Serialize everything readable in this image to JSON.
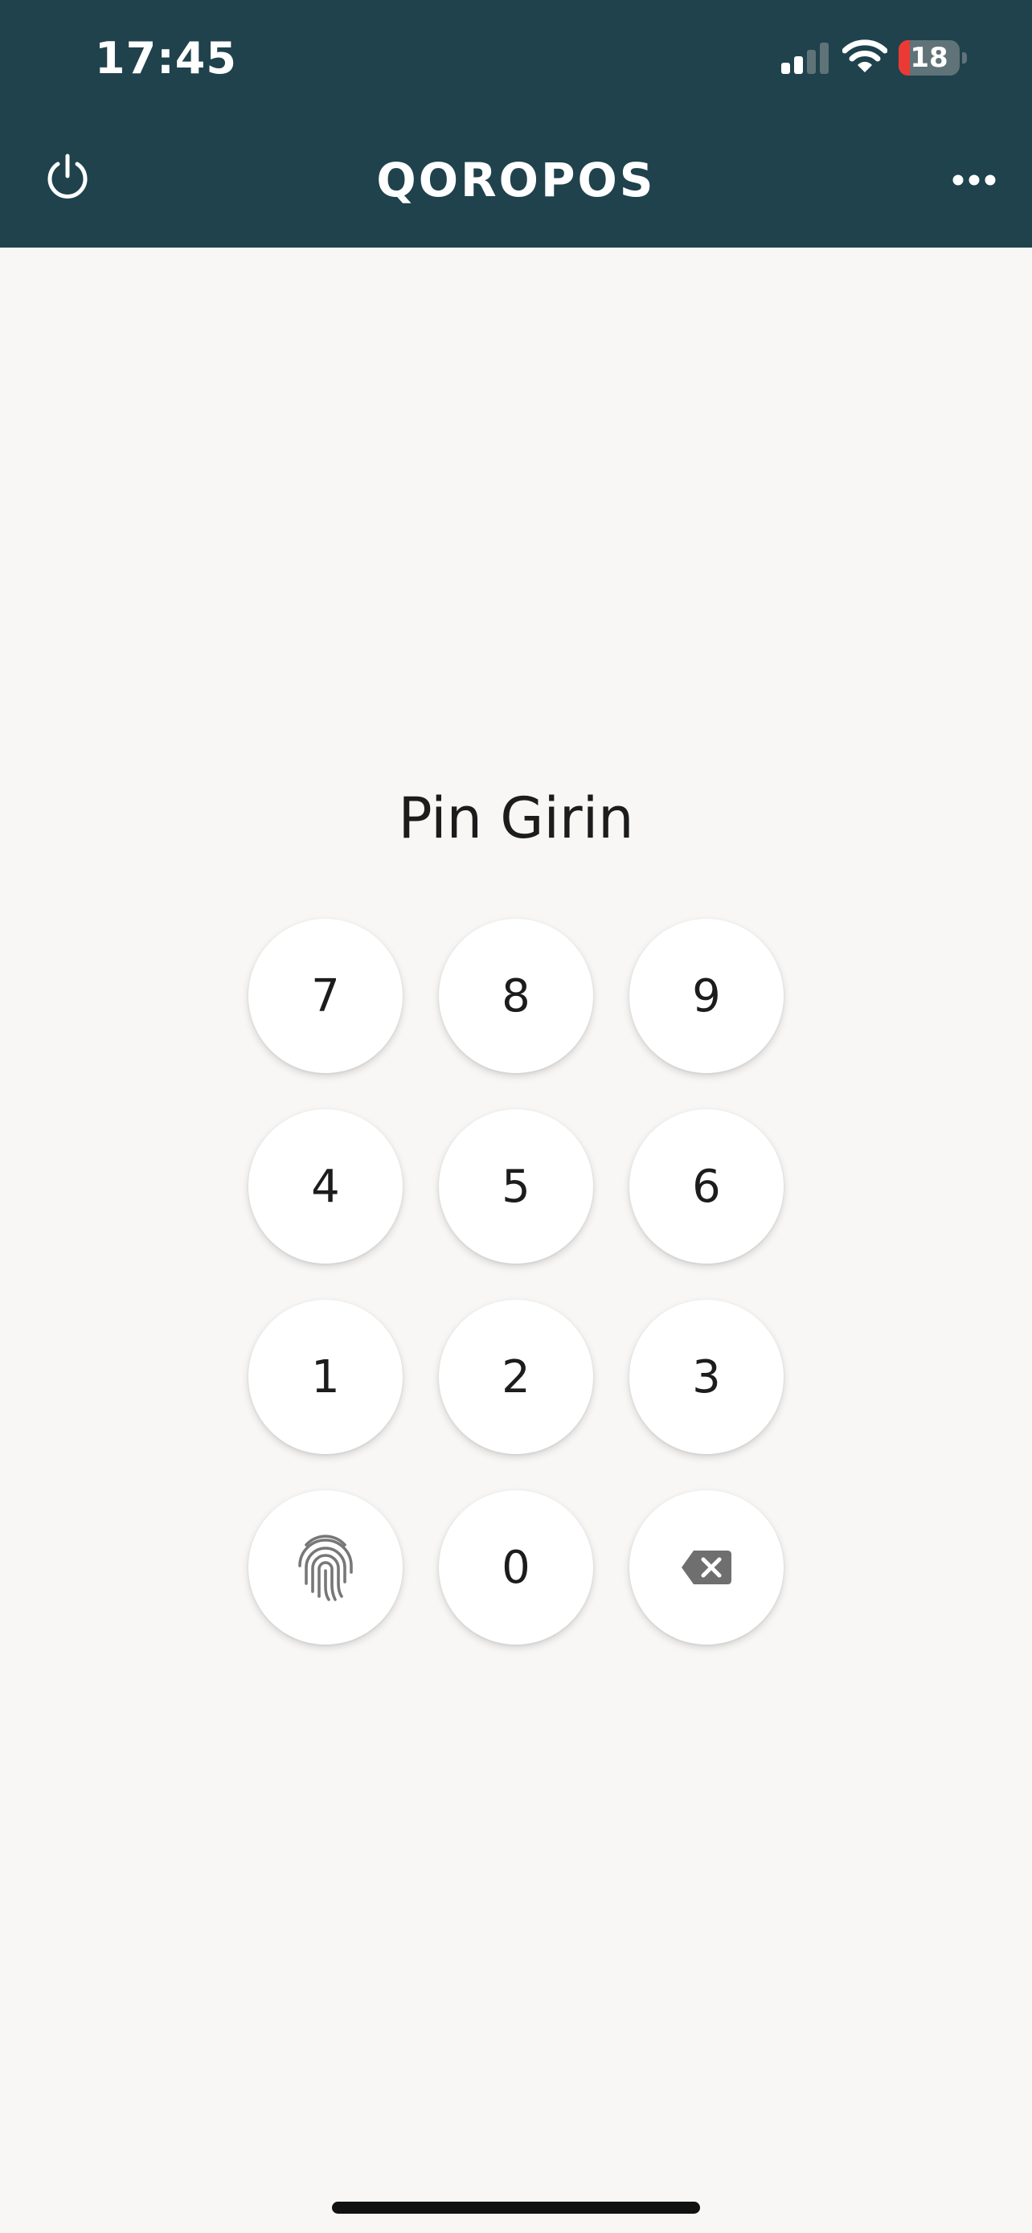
{
  "status_bar": {
    "time": "17:45",
    "battery_level": "18",
    "battery_fraction": 0.18,
    "icons": [
      "signal-icon",
      "wifi-icon",
      "battery-icon"
    ]
  },
  "header": {
    "title": "QOROPOS",
    "left_icon": "power-icon",
    "right_icon": "more-icon"
  },
  "pin_screen": {
    "title": "Pin Girin",
    "keys": {
      "k7": "7",
      "k8": "8",
      "k9": "9",
      "k4": "4",
      "k5": "5",
      "k6": "6",
      "k1": "1",
      "k2": "2",
      "k3": "3",
      "k0": "0"
    },
    "biometric_icon": "fingerprint-icon",
    "delete_icon": "backspace-icon"
  },
  "colors": {
    "header_background": "#1f424d",
    "page_background": "#f8f7f6",
    "key_background": "#ffffff",
    "battery_low": "#eb3a34"
  }
}
